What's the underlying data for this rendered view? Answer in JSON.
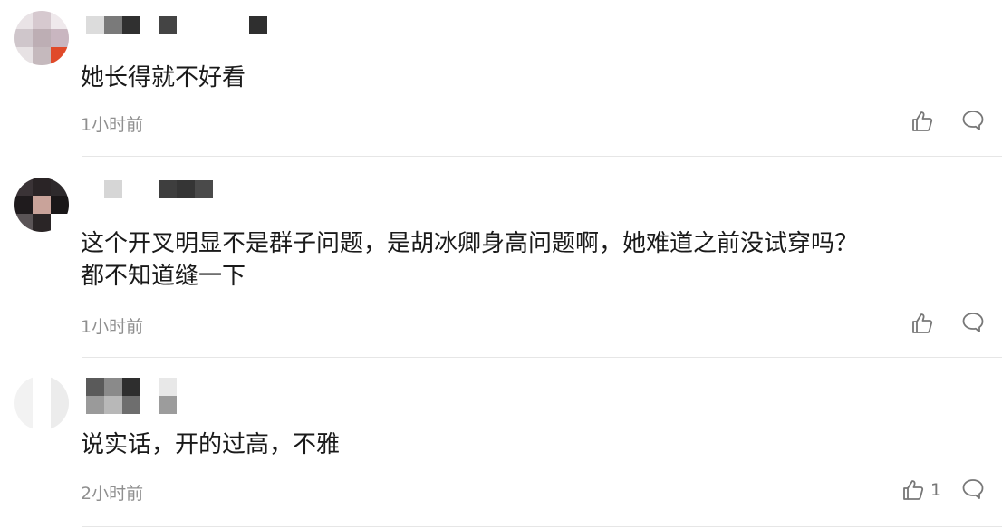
{
  "comments": [
    {
      "text": "她长得就不好看",
      "time": "1小时前",
      "like_count": ""
    },
    {
      "text": "这个开叉明显不是群子问题，是胡冰卿身高问题啊，她难道之前没试穿吗？\n都不知道缝一下",
      "time": "1小时前",
      "like_count": ""
    },
    {
      "text": "说实话，开的过高，不雅",
      "time": "2小时前",
      "like_count": "1"
    }
  ],
  "icons": {
    "like": "thumbs-up-icon",
    "reply": "comment-bubble-icon"
  },
  "colors": {
    "text": "#1a1a1a",
    "meta": "#8f8f8f",
    "icon": "#777777",
    "divider": "#e6e6e6"
  }
}
